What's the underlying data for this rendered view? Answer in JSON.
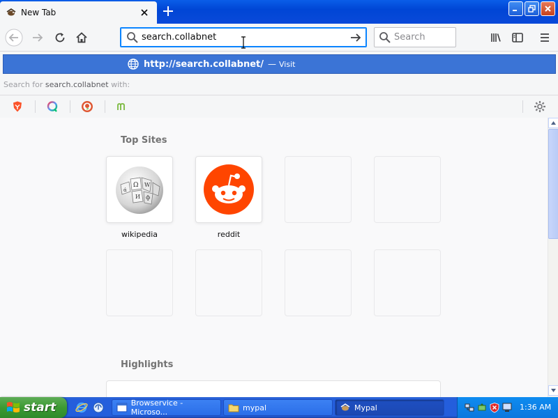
{
  "browser": {
    "tab": {
      "title": "New Tab"
    },
    "urlbar": {
      "value": "search.collabnet"
    },
    "searchbar": {
      "placeholder": "Search"
    }
  },
  "autocomplete": {
    "visit_url_prefix": "http://",
    "visit_url_domain": "search.collabnet",
    "visit_url_suffix": "/",
    "visit_separator": "—",
    "visit_action": "Visit",
    "search_for_prefix": "Search for",
    "search_term": "search.collabnet",
    "search_for_suffix": "with:",
    "engines": [
      "brave-icon",
      "qwant-icon",
      "duckduckgo-icon",
      "mojeek-icon"
    ]
  },
  "newtab": {
    "top_sites_title": "Top Sites",
    "top_sites": [
      {
        "label": "wikipedia",
        "icon": "wikipedia-globe-icon"
      },
      {
        "label": "reddit",
        "icon": "reddit-alien-icon"
      }
    ],
    "highlights_title": "Highlights"
  },
  "taskbar": {
    "start_label": "start",
    "tasks": [
      {
        "label": "Browservice - Microso..."
      },
      {
        "label": "mypal"
      },
      {
        "label": "Mypal"
      }
    ],
    "clock": "1:36 AM"
  },
  "colors": {
    "accent": "#0a84ff",
    "autocomplete_highlight": "#3b74d6",
    "reddit": "#ff4500",
    "xp_blue": "#245edc",
    "xp_start_green": "#3c9a33"
  }
}
